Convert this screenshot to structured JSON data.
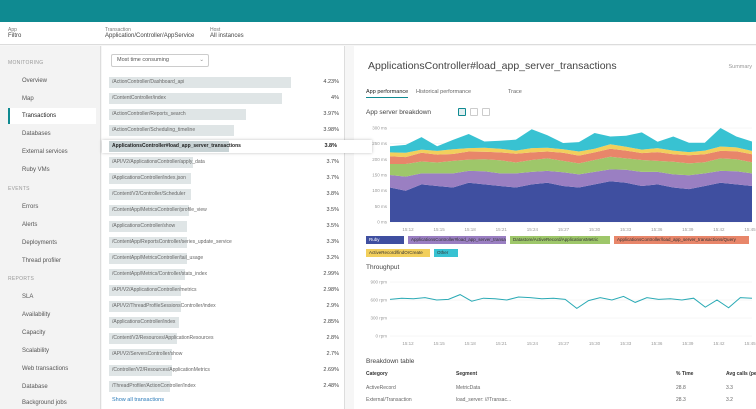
{
  "header": {
    "color": "#0f8a91"
  },
  "selectors": [
    {
      "label": "App",
      "value": "Filtro"
    },
    {
      "label": "Transaction",
      "value": "Application/Controller/AppService"
    },
    {
      "label": "Host",
      "value": "All instances"
    }
  ],
  "sidebar": {
    "groups": [
      {
        "title": "MONITORING",
        "items": [
          "Overview",
          "Map",
          "Transactions",
          "Databases",
          "External services",
          "Ruby VMs"
        ]
      },
      {
        "title": "EVENTS",
        "items": [
          "Errors",
          "Alerts",
          "Deployments",
          "Thread profiler"
        ]
      },
      {
        "title": "REPORTS",
        "items": [
          "SLA",
          "Availability",
          "Capacity",
          "Scalability",
          "Web transactions",
          "Database",
          "Background jobs"
        ]
      }
    ],
    "active": "Transactions"
  },
  "list": {
    "sort_label": "Most time consuming",
    "show_all": "Show all transactions",
    "rows": [
      {
        "name": "/ActionController/Dashboard_api",
        "time": "4.23%",
        "pct": 0.96
      },
      {
        "name": "/ContentController/index",
        "time": "4%",
        "pct": 0.91
      },
      {
        "name": "/ActionController/Reports_search",
        "time": "3.97%",
        "pct": 0.72
      },
      {
        "name": "/ActionController/Scheduling_timeline",
        "time": "3.98%",
        "pct": 0.66
      },
      {
        "name": "ApplicationsController#load_app_server_transactions",
        "time": "3.8%",
        "pct": 0.63,
        "selected": true
      },
      {
        "name": "/API/V2/ApplicationsController/apply_data",
        "time": "3.7%",
        "pct": 0.44
      },
      {
        "name": "/ApplicationsController/index.json",
        "time": "3.7%",
        "pct": 0.43
      },
      {
        "name": "/Content/V2/Controller/Scheduler",
        "time": "3.8%",
        "pct": 0.43
      },
      {
        "name": "/ContentApp/MetricsController/profile_view",
        "time": "3.5%",
        "pct": 0.42
      },
      {
        "name": "/ApplicationsController/show",
        "time": "3.5%",
        "pct": 0.41
      },
      {
        "name": "/ContentApp/ReportsController/series_update_service",
        "time": "3.3%",
        "pct": 0.41
      },
      {
        "name": "/ContentApp/MetricsController/tail_usage",
        "time": "3.2%",
        "pct": 0.41
      },
      {
        "name": "/ContentApp/Metrics/Controller/stats_index",
        "time": "2.99%",
        "pct": 0.4
      },
      {
        "name": "/API/V2/ApplicationsController/metrics",
        "time": "2.98%",
        "pct": 0.38
      },
      {
        "name": "/API/V2/ThreadProfileSessionsController/index",
        "time": "2.9%",
        "pct": 0.38
      },
      {
        "name": "/ApplicationsController/index",
        "time": "2.85%",
        "pct": 0.37
      },
      {
        "name": "/Content/V2/Resources/ApplicationResources",
        "time": "2.8%",
        "pct": 0.36
      },
      {
        "name": "/API/V2/ServersController/show",
        "time": "2.7%",
        "pct": 0.33
      },
      {
        "name": "/Controller/V2/Resources/ApplicationMetrics",
        "time": "2.69%",
        "pct": 0.33
      },
      {
        "name": "/ThreadProfiler/ActionController/Index",
        "time": "2.48%",
        "pct": 0.32
      }
    ]
  },
  "detail": {
    "title": "ApplicationsController#load_app_server_transactions",
    "right_label": "Summary",
    "tabs": [
      "App performance",
      "Historical performance",
      "Trace"
    ],
    "breakdown_title": "App server breakdown",
    "throughput_title": "Throughput",
    "breakdown_table_title": "Breakdown table",
    "legend": [
      {
        "label": "Ruby",
        "color": "#3f4fa0"
      },
      {
        "label": "ApplicationsController#load_app_server_transactions",
        "color": "#9a7fc2"
      },
      {
        "label": "Datastore/ActiveRecord/ApplicationsMetric",
        "color": "#9ec76a"
      },
      {
        "label": "ApplicationsController/load_app_server_transactions/Query",
        "color": "#e8866a"
      },
      {
        "label": "ActiveRecord/findOrCreate",
        "color": "#f2cf5c"
      },
      {
        "label": "Other",
        "color": "#38c2d2"
      }
    ],
    "table": {
      "headers": [
        "Category",
        "Segment",
        "% Time",
        "Avg calls (per txn)"
      ],
      "rows": [
        [
          "ActiveRecord",
          "MetricData",
          "28.8",
          "3.3"
        ],
        [
          "External/Transaction",
          "load_server: ///Transac...",
          "28.3",
          "3.2"
        ],
        [
          "ActiveRecord",
          "ApplicationTransactionMetric#find",
          "18.3",
          "3.1"
        ]
      ]
    },
    "breakdown_y_ticks": [
      "300 ms",
      "250 ms",
      "200 ms",
      "150 ms",
      "100 ms",
      "50 ms",
      "0 ms"
    ],
    "throughput_y_ticks": [
      "900 rpm",
      "600 rpm",
      "300 rpm",
      "0 rpm"
    ],
    "x_ticks": [
      "15:12",
      "15:15",
      "15:18",
      "15:21",
      "15:24",
      "15:27",
      "15:30",
      "15:33",
      "15:36",
      "15:39",
      "15:42",
      "15:45"
    ],
    "breakdown_series": [
      {
        "name": "Ruby",
        "values": [
          110,
          100,
          120,
          115,
          110,
          125,
          120,
          115,
          110,
          120,
          125,
          115,
          110,
          120,
          130,
          125,
          115,
          120,
          110,
          105,
          115,
          125,
          120,
          115
        ]
      },
      {
        "name": "App",
        "values": [
          40,
          45,
          35,
          40,
          45,
          38,
          42,
          40,
          45,
          40,
          38,
          44,
          42,
          40,
          38,
          42,
          45,
          40,
          42,
          44,
          40,
          38,
          42,
          40
        ]
      },
      {
        "name": "Datastore",
        "values": [
          35,
          40,
          38,
          35,
          40,
          36,
          38,
          42,
          35,
          38,
          40,
          36,
          35,
          38,
          40,
          36,
          38,
          35,
          40,
          38,
          36,
          40,
          38,
          36
        ]
      },
      {
        "name": "Query",
        "values": [
          25,
          22,
          28,
          25,
          22,
          26,
          24,
          25,
          28,
          24,
          22,
          26,
          25,
          24,
          26,
          25,
          22,
          28,
          24,
          26,
          25,
          24,
          26,
          25
        ]
      },
      {
        "name": "findOrCreate",
        "values": [
          12,
          14,
          10,
          12,
          15,
          11,
          13,
          12,
          10,
          14,
          12,
          11,
          13,
          12,
          14,
          12,
          11,
          13,
          12,
          10,
          12,
          14,
          12,
          11
        ]
      },
      {
        "name": "Other",
        "values": [
          20,
          25,
          40,
          15,
          30,
          45,
          20,
          25,
          35,
          60,
          40,
          20,
          30,
          50,
          25,
          35,
          55,
          20,
          45,
          30,
          25,
          60,
          35,
          30
        ]
      }
    ],
    "throughput_values": [
      610,
      630,
      620,
      640,
      600,
      610,
      690,
      580,
      630,
      620,
      600,
      650,
      640,
      620,
      630,
      610,
      460,
      590,
      640,
      600,
      660,
      560,
      640,
      610,
      620,
      600,
      630,
      480,
      600,
      470,
      640,
      630
    ]
  }
}
